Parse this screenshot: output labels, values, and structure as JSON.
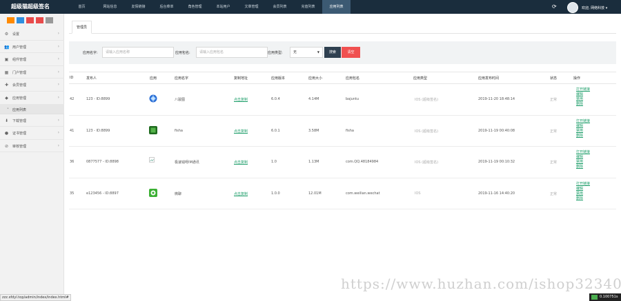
{
  "brand": "超级猫超级签名",
  "nav": [
    "首页",
    "网站信息",
    "友情链接",
    "后台菜单",
    "角色管理",
    "本站用户",
    "文章管理",
    "会员列表",
    "充值列表",
    "应用列表"
  ],
  "nav_active_index": 9,
  "user": {
    "welcome": "欢迎, 网络科技 ▾"
  },
  "colors": {
    "topbar": "#1a2d3d",
    "nav_active": "#3c5a73",
    "link": "#1e9e6a",
    "search": "#2f4050",
    "clear": "#f05050"
  },
  "quick_buttons": [
    {
      "color": "#ff8a00"
    },
    {
      "color": "#2f8fe0"
    },
    {
      "color": "#e84a4a"
    },
    {
      "color": "#e84a4a"
    },
    {
      "color": "#999999"
    }
  ],
  "sidebar": {
    "items": [
      {
        "icon": "gear-icon",
        "glyph": "⚙",
        "label": "设置"
      },
      {
        "icon": "users-icon",
        "glyph": "👥",
        "label": "用户管理"
      },
      {
        "icon": "puzzle-icon",
        "glyph": "▣",
        "label": "组件管理"
      },
      {
        "icon": "grid-icon",
        "glyph": "▦",
        "label": "门户管理"
      },
      {
        "icon": "plus-icon",
        "glyph": "✚",
        "label": "会员管理"
      },
      {
        "icon": "android-icon",
        "glyph": "◆",
        "label": "应用管理"
      }
    ],
    "sub_item": "应用列表",
    "items_after": [
      {
        "icon": "download-icon",
        "glyph": "⬇",
        "label": "下载管理"
      },
      {
        "icon": "certificate-icon",
        "glyph": "●",
        "label": "证书管理"
      },
      {
        "icon": "audit-icon",
        "glyph": "⊘",
        "label": "审核管理"
      }
    ]
  },
  "tab": "管理员",
  "filter": {
    "name_label": "应用名字:",
    "name_placeholder": "请输入应用名称",
    "pkg_label": "应用包名:",
    "pkg_placeholder": "请输入应用包名",
    "type_label": "应用类型:",
    "type_value": "无",
    "search_label": "搜索",
    "clear_label": "清空"
  },
  "table": {
    "headers": [
      "ID",
      "发布人",
      "应用",
      "应用名字",
      "复制地址",
      "应用版本",
      "应用大小",
      "应用包名",
      "应用类型",
      "应用发布时间",
      "状态",
      "操作"
    ],
    "rows": [
      {
        "id": "42",
        "publisher": "123 - ID:8899",
        "icon": "globe",
        "name": "八骏图",
        "copy": "点击复制",
        "version": "6.0.4",
        "size": "4.14M",
        "pkg": "bajuntu",
        "type": "IOS (超级签名)",
        "time": "2019-11-20 18:48:14",
        "status": "正常"
      },
      {
        "id": "41",
        "publisher": "123 - ID:8899",
        "icon": "green",
        "name": "fisha",
        "copy": "点击复制",
        "version": "6.0.1",
        "size": "3.58M",
        "pkg": "fisha",
        "type": "IOS (超级签名)",
        "time": "2019-11-19 00:40:08",
        "status": "正常"
      },
      {
        "id": "36",
        "publisher": "0877577 - ID:8898",
        "icon": "broken",
        "name": "极速钱呀IM通讯",
        "copy": "点击复制",
        "version": "1.0",
        "size": "1.13M",
        "pkg": "com.QQ.48184984",
        "type": "IOS (超级签名)",
        "time": "2019-11-19 00:10:32",
        "status": "正常"
      },
      {
        "id": "35",
        "publisher": "e123456 - ID:8897",
        "icon": "wechat",
        "name": "微聊",
        "copy": "点击复制",
        "version": "1.0.0",
        "size": "12.01M",
        "pkg": "com.weilian.wechat",
        "type": "IOS",
        "time": "2019-11-16 14:40:20",
        "status": "正常"
      }
    ],
    "ops": [
      "打开链接",
      "编辑",
      "禁用",
      "删除"
    ]
  },
  "status_url": "zzz.xfdyl.top/admin/index/index.html#",
  "net_speed": "0.100751s",
  "watermark": "https://www.huzhan.com/ishop32340"
}
